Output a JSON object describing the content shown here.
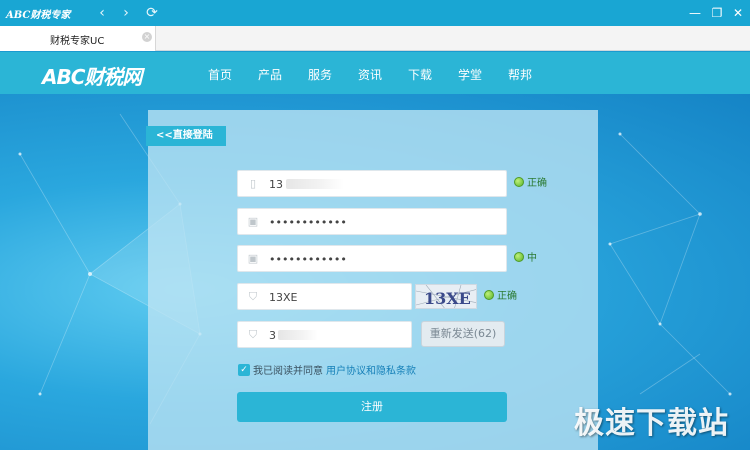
{
  "window": {
    "title": "ABC财税专家",
    "back_icon": "‹",
    "forward_icon": "›",
    "refresh_icon": "⟳",
    "minimize_icon": "—",
    "restore_icon": "❐",
    "close_icon": "✕"
  },
  "tabs": [
    {
      "label": "财税专家UC",
      "close": "×"
    }
  ],
  "site": {
    "logo_text": "ABC财税网",
    "nav": [
      "首页",
      "产品",
      "服务",
      "资讯",
      "下载",
      "学堂",
      "帮邦"
    ]
  },
  "form": {
    "back_link": "<<直接登陆",
    "phone_value": "13",
    "password_value": "••••••••••••",
    "confirm_password_value": "••••••••••••",
    "captcha_value": "13XE",
    "captcha_image_text": "13XE",
    "sms_code_value": "3",
    "resend_label": "重新发送(62)",
    "status_phone": "正确",
    "status_strength": "中",
    "status_captcha": "正确",
    "agree_text": "我已阅读并同意",
    "agree_link": "用户协议和隐私条款",
    "agree_checked": true,
    "submit_label": "注册"
  },
  "watermark": "极速下载站",
  "colors": {
    "accent": "#2bb5d6",
    "titlebar": "#19a6d3",
    "status_green": "#5bb52b"
  }
}
